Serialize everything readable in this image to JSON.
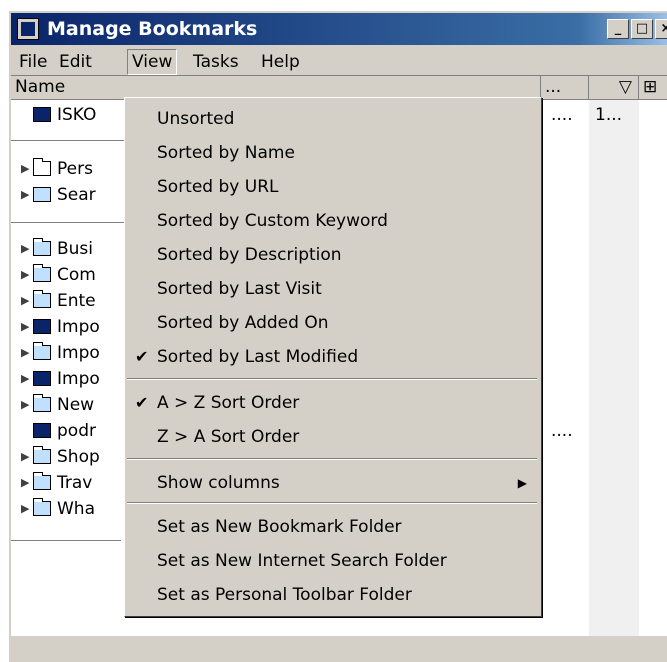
{
  "window": {
    "title": "Manage Bookmarks",
    "btn_min": "_",
    "btn_max": "□",
    "btn_close": "×"
  },
  "menubar": {
    "file": "File",
    "edit": "Edit",
    "view": "View",
    "tasks": "Tasks",
    "help": "Help"
  },
  "columns": {
    "name": "Name",
    "col2": "...",
    "sort_indicator": "▽",
    "col_picker": "⊞"
  },
  "rows": [
    {
      "label": "ISKO",
      "extra": "....",
      "extra2": "1...",
      "icon": "bookmark-icon"
    },
    {
      "label": "Pers",
      "icon": "folder-icon"
    },
    {
      "label": "Sear",
      "icon": "search-folder-icon"
    },
    {
      "label": "Busi",
      "icon": "folder-icon"
    },
    {
      "label": "Com",
      "icon": "folder-icon"
    },
    {
      "label": "Ente",
      "icon": "folder-icon"
    },
    {
      "label": "Impo",
      "icon": "bookmark-folder-icon"
    },
    {
      "label": "Impo",
      "icon": "folder-icon"
    },
    {
      "label": "Impo",
      "icon": "bookmark-folder-icon"
    },
    {
      "label": "New",
      "icon": "folder-icon"
    },
    {
      "label": "podr",
      "extra": "....",
      "icon": "bookmark-icon"
    },
    {
      "label": "Shop",
      "icon": "folder-icon"
    },
    {
      "label": "Trav",
      "icon": "folder-icon"
    },
    {
      "label": "Wha",
      "icon": "folder-icon"
    }
  ],
  "view_menu": {
    "items": [
      "Unsorted",
      "Sorted by Name",
      "Sorted by URL",
      "Sorted by Custom Keyword",
      "Sorted by Description",
      "Sorted by Last Visit",
      "Sorted by Added On",
      "Sorted by Last Modified",
      "A > Z Sort Order",
      "Z > A Sort Order",
      "Show columns",
      "Set as New Bookmark Folder",
      "Set as New Internet Search Folder",
      "Set as Personal Toolbar Folder"
    ],
    "check": "✔",
    "submenu_arrow": "▶",
    "checked": [
      "Sorted by Last Modified",
      "A > Z Sort Order"
    ]
  }
}
